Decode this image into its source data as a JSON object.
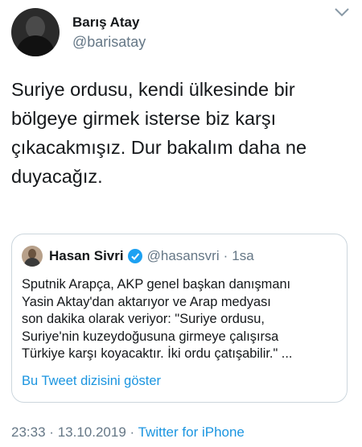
{
  "author": {
    "display_name": "Barış Atay",
    "handle": "@barisatay"
  },
  "tweet": {
    "text": "Suriye ordusu, kendi ülkesinde bir bölgeye girmek isterse biz karşı çıkacakmışız. Dur bakalım daha ne duyacağız."
  },
  "quoted_tweet": {
    "display_name": "Hasan Sivri",
    "handle": "@hasansvri",
    "separator": "·",
    "time": "1sa",
    "text": "Sputnik Arapça, AKP genel başkan danışmanı\nYasin Aktay'dan aktarıyor ve Arap medyası\nson dakika olarak veriyor: \"Suriye ordusu,\nSuriye'nin kuzeydoğusuna girmeye çalışırsa\nTürkiye karşı koyacaktır. İki ordu çatışabilir.\" ...",
    "show_thread": "Bu Tweet dizisini göster"
  },
  "meta": {
    "time": "23:33",
    "separator1": "·",
    "date": "13.10.2019",
    "separator2": "·",
    "source": "Twitter for iPhone"
  },
  "colors": {
    "link": "#1b95e0",
    "secondary_text": "#657786",
    "border": "#ccd6dd",
    "verified": "#1da1f2"
  },
  "icons": {
    "menu": "chevron-down-icon",
    "verified": "verified-badge-icon"
  }
}
